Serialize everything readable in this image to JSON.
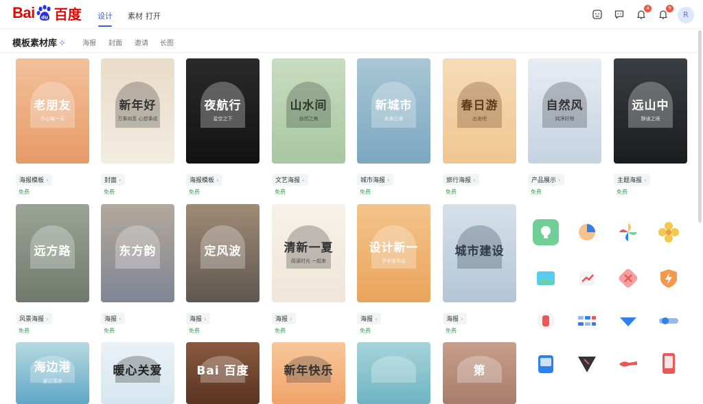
{
  "header": {
    "logo_latin": "Bai",
    "logo_cn": "百度",
    "tabs": [
      {
        "label": "设计"
      },
      {
        "label": "素材"
      },
      {
        "label": "打开"
      }
    ],
    "badges": {
      "notify": "4",
      "message": "9"
    },
    "avatar": "R"
  },
  "section": {
    "title": "模板素材库",
    "filters": [
      "海报",
      "封面",
      "邀请",
      "长图"
    ]
  },
  "cards": [
    {
      "title": "老朋友",
      "sub": "开心每一天",
      "tag": "海报模板",
      "price": "免费",
      "bg": "#e79a66",
      "bg2": "#f2c19a",
      "fg": "#ffffff"
    },
    {
      "title": "新年好",
      "sub": "万事如意 心想事成",
      "tag": "封面",
      "price": "免费",
      "bg": "#f3ece0",
      "bg2": "#e9dcc8",
      "fg": "#333333"
    },
    {
      "title": "夜航行",
      "sub": "星空之下",
      "tag": "海报模板",
      "price": "免费",
      "bg": "#121212",
      "bg2": "#2a2a2a",
      "fg": "#ffffff"
    },
    {
      "title": "山水间",
      "sub": "自然之美",
      "tag": "文艺海报",
      "price": "免费",
      "bg": "#a7c7a0",
      "bg2": "#c8dcc0",
      "fg": "#2b3a2b"
    },
    {
      "title": "新城市",
      "sub": "未来已来",
      "tag": "城市海报",
      "price": "免费",
      "bg": "#7ba7bf",
      "bg2": "#a9c7d6",
      "fg": "#ffffff"
    },
    {
      "title": "春日游",
      "sub": "出发吧",
      "tag": "旅行海报",
      "price": "免费",
      "bg": "#f0c590",
      "bg2": "#f6dcb6",
      "fg": "#5a3a1a"
    },
    {
      "title": "自然风",
      "sub": "纯净好物",
      "tag": "产品展示",
      "price": "免费",
      "bg": "#c5d3e2",
      "bg2": "#e6ecf3",
      "fg": "#333333"
    },
    {
      "title": "远山中",
      "sub": "静谧之境",
      "tag": "主题海报",
      "price": "免费",
      "bg": "#1a1c1e",
      "bg2": "#3a3e42",
      "fg": "#ffffff"
    },
    {
      "title": "远方路",
      "sub": "",
      "tag": "风景海报",
      "price": "免费",
      "bg": "#6f7a6d",
      "bg2": "#9aa596",
      "fg": "#ffffff"
    },
    {
      "title": "东方韵",
      "sub": "",
      "tag": "海报",
      "price": "免费",
      "bg": "#7f8595",
      "bg2": "#b4a89b",
      "fg": "#ffffff"
    },
    {
      "title": "定风波",
      "sub": "",
      "tag": "海报",
      "price": "免费",
      "bg": "#5f5750",
      "bg2": "#a08a74",
      "fg": "#ffffff"
    },
    {
      "title": "清新一夏",
      "sub": "阅读时光 一起来",
      "tag": "海报",
      "price": "免费",
      "bg": "#efe6d8",
      "bg2": "#f7f1e8",
      "fg": "#333333"
    },
    {
      "title": "设计新一",
      "sub": "学术发布会",
      "tag": "海报",
      "price": "免费",
      "bg": "#e9a45c",
      "bg2": "#f3c48a",
      "fg": "#ffffff"
    },
    {
      "title": "城市建设",
      "sub": "",
      "tag": "海报",
      "price": "免费",
      "bg": "#b3c6d6",
      "bg2": "#d6e1ea",
      "fg": "#2b3b4b"
    },
    {
      "title": "海边港",
      "sub": "夏日清凉",
      "tag": "",
      "price": "",
      "bg": "#5fa7c7",
      "bg2": "#b6d9df",
      "fg": "#ffffff"
    },
    {
      "title": "暖心关爱",
      "sub": "",
      "tag": "",
      "price": "",
      "bg": "#d5e6ef",
      "bg2": "#eaf2f6",
      "fg": "#222222"
    },
    {
      "title": "Bai 百度",
      "sub": "",
      "tag": "",
      "price": "",
      "bg": "#5a3322",
      "bg2": "#8a5a3f",
      "fg": "#ffffff"
    },
    {
      "title": "新年快乐",
      "sub": "",
      "tag": "",
      "price": "",
      "bg": "#f1a36a",
      "bg2": "#f7c79a",
      "fg": "#333333"
    },
    {
      "title": "",
      "sub": "",
      "tag": "",
      "price": "",
      "bg": "#6fb3c2",
      "bg2": "#a7d4da",
      "fg": "#ffffff"
    },
    {
      "title": "第",
      "sub": "",
      "tag": "",
      "price": "",
      "bg": "#a77c6d",
      "bg2": "#c89f8a",
      "fg": "#ffffff"
    }
  ],
  "icons": [
    {
      "name": "lightbulb-icon",
      "color": "#6fcf97"
    },
    {
      "name": "pie-chart-icon",
      "color": "#f2994a"
    },
    {
      "name": "pinwheel-icon",
      "color": "#bb6bd9"
    },
    {
      "name": "flower-icon",
      "color": "#f2c94c"
    },
    {
      "name": "image-icon",
      "color": "#56ccf2"
    },
    {
      "name": "chart-icon",
      "color": "#eb5757"
    },
    {
      "name": "close-icon",
      "color": "#eb5757"
    },
    {
      "name": "lightning-shield-icon",
      "color": "#f2994a"
    },
    {
      "name": "cup-icon",
      "color": "#eb5757"
    },
    {
      "name": "dots-icon",
      "color": "#2f80ed"
    },
    {
      "name": "scarf-icon",
      "color": "#2f80ed"
    },
    {
      "name": "toggle-icon",
      "color": "#2f80ed"
    },
    {
      "name": "tv-icon",
      "color": "#2f80ed"
    },
    {
      "name": "shield-dark-icon",
      "color": "#333333"
    },
    {
      "name": "brush-icon",
      "color": "#eb5757"
    },
    {
      "name": "phone-icon",
      "color": "#eb5757"
    }
  ]
}
